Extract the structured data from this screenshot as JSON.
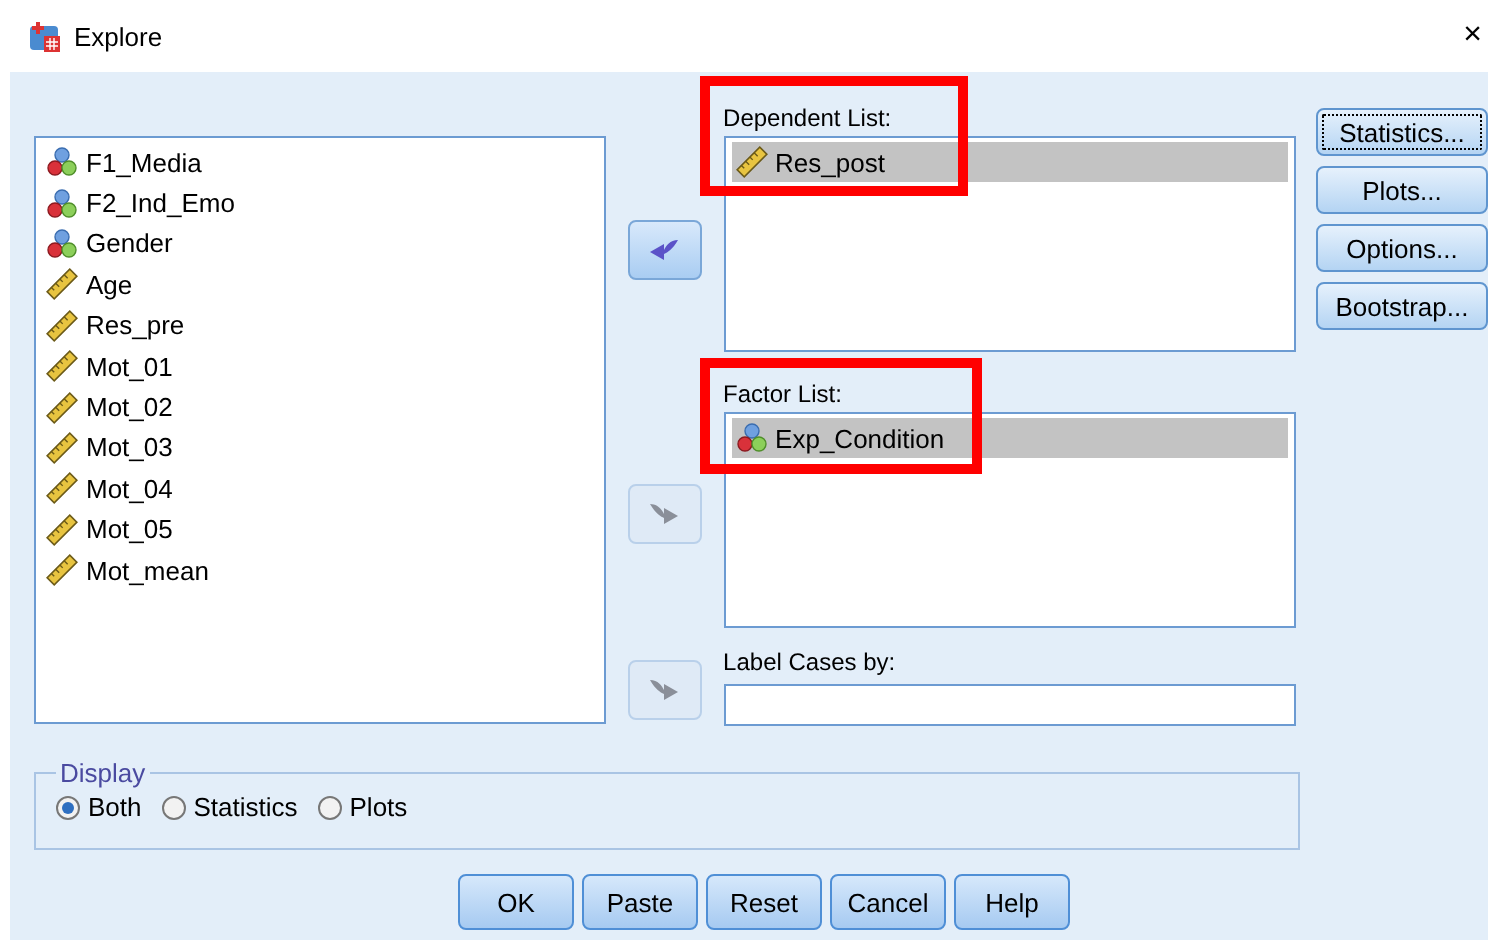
{
  "window": {
    "title": "Explore",
    "close": "×"
  },
  "source_list": {
    "items": [
      {
        "label": "F1_Media",
        "kind": "nominal",
        "selected": false
      },
      {
        "label": "F2_Ind_Emo",
        "kind": "nominal",
        "selected": false
      },
      {
        "label": "Gender",
        "kind": "nominal",
        "selected": false
      },
      {
        "label": "Age",
        "kind": "scale",
        "selected": false
      },
      {
        "label": "Res_pre",
        "kind": "scale",
        "selected": false
      },
      {
        "label": "Mot_01",
        "kind": "scale",
        "selected": false
      },
      {
        "label": "Mot_02",
        "kind": "scale",
        "selected": false
      },
      {
        "label": "Mot_03",
        "kind": "scale",
        "selected": false
      },
      {
        "label": "Mot_04",
        "kind": "scale",
        "selected": false
      },
      {
        "label": "Mot_05",
        "kind": "scale",
        "selected": false
      },
      {
        "label": "Mot_mean",
        "kind": "scale",
        "selected": false
      }
    ]
  },
  "move_buttons": [
    {
      "kind": "left",
      "disabled": false
    },
    {
      "kind": "right",
      "disabled": true
    },
    {
      "kind": "right",
      "disabled": true
    }
  ],
  "dependent_list": {
    "label": "Dependent List:",
    "highlighted": true,
    "items": [
      {
        "label": "Res_post",
        "kind": "scale",
        "selected": true
      }
    ]
  },
  "factor_list": {
    "label": "Factor List:",
    "highlighted": true,
    "items": [
      {
        "label": "Exp_Condition",
        "kind": "nominal",
        "selected": true
      }
    ]
  },
  "label_cases": {
    "label": "Label Cases by:"
  },
  "side_buttons": [
    {
      "label": "Statistics...",
      "focused": true
    },
    {
      "label": "Plots...",
      "focused": false
    },
    {
      "label": "Options...",
      "focused": false
    },
    {
      "label": "Bootstrap...",
      "focused": false
    }
  ],
  "display": {
    "legend": "Display",
    "options": [
      {
        "label": "Both",
        "selected": true
      },
      {
        "label": "Statistics",
        "selected": false
      },
      {
        "label": "Plots",
        "selected": false
      }
    ]
  },
  "buttons": [
    "OK",
    "Paste",
    "Reset",
    "Cancel",
    "Help"
  ]
}
